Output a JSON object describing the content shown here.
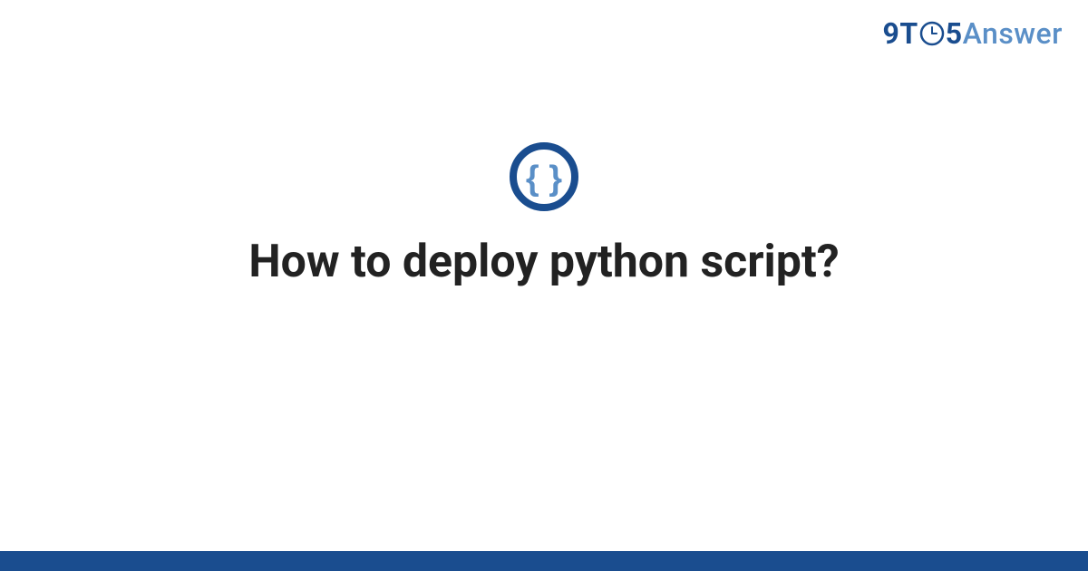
{
  "logo": {
    "part1": "9T",
    "part2": "5",
    "part3": "Answer"
  },
  "main": {
    "title": "How to deploy python script?"
  },
  "colors": {
    "brand_dark": "#1a4d8f",
    "brand_light": "#5a8fc7",
    "text": "#222222"
  }
}
